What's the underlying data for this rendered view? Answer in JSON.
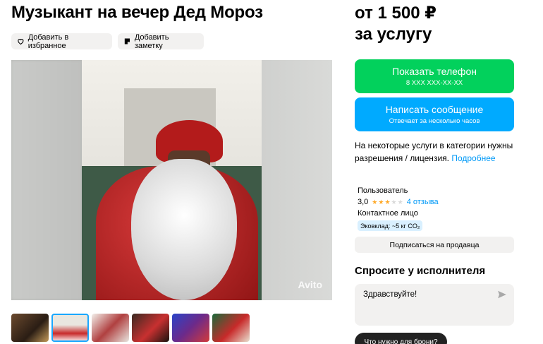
{
  "listing": {
    "title": "Музыкант на вечер Дед Мороз",
    "favorite_label": "Добавить в избранное",
    "note_label": "Добавить заметку",
    "photo_watermark": "Avito"
  },
  "pricing": {
    "price_line": "от 1 500 ₽",
    "price_unit": "за услугу"
  },
  "actions": {
    "phone_label": "Показать телефон",
    "phone_number": "8 XXX XXX-XX-XX",
    "message_label": "Написать сообщение",
    "message_sub": "Отвечает за несколько часов"
  },
  "license": {
    "text": "На некоторые услуги в категории нужны разрешения / лицензия. ",
    "link": "Подробнее"
  },
  "seller": {
    "name": "Пользователь",
    "rating": "3,0",
    "stars_filled": 3,
    "stars_total": 5,
    "reviews": "4 отзыва",
    "contact": "Контактное лицо",
    "eco_badge": "Эковклад: ~5 кг CO₂",
    "subscribe_label": "Подписаться на продавца"
  },
  "ask": {
    "title": "Спросите у исполнителя",
    "input_value": "Здравствуйте!",
    "chip_label": "Что нужно для брони?"
  },
  "colors": {
    "phone_button": "#02d15c",
    "message_button": "#00aaff",
    "link": "#0099f7",
    "star_filled": "#ffa928",
    "star_empty": "#d9d9d9"
  },
  "thumbnails": {
    "count": 6,
    "active_index": 1
  }
}
